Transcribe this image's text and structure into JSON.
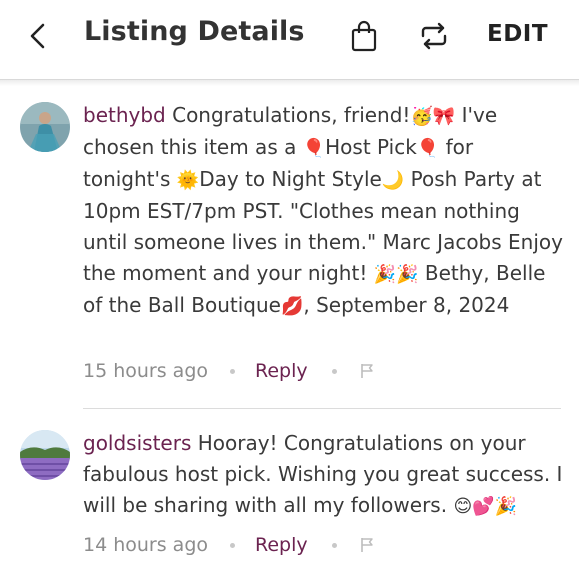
{
  "header": {
    "title": "Listing Details",
    "edit_label": "EDIT",
    "back_icon": "chevron-left-icon",
    "bag_icon": "shopping-bag-icon",
    "share_icon": "repost-icon"
  },
  "colors": {
    "username": "#6b2350",
    "reply": "#6b2350",
    "text": "#3a3a3a",
    "meta": "#8c8c8c"
  },
  "comments": [
    {
      "username": "bethybd",
      "segments": [
        " Congratulations, friend!",
        "🥳🎀",
        " I've chosen this item as a ",
        "🎈",
        "Host Pick",
        "🎈",
        " for tonight's ",
        "🌞",
        "Day to Night Style",
        "🌙",
        " Posh Party at 10pm EST/7pm PST.  \"Clothes mean nothing until someone lives in them.\" Marc Jacobs Enjoy the moment and your night! ",
        "🎉🎉",
        " Bethy, Belle of the Ball Boutique",
        "💋",
        ", September 8, 2024"
      ],
      "time": "15 hours ago",
      "reply_label": "Reply"
    },
    {
      "username": "goldsisters",
      "segments": [
        " Hooray! Congratulations on your fabulous host pick. Wishing you great success. I will be sharing with all my followers. ",
        "😊💕🎉"
      ],
      "time": "14 hours ago",
      "reply_label": "Reply"
    }
  ]
}
